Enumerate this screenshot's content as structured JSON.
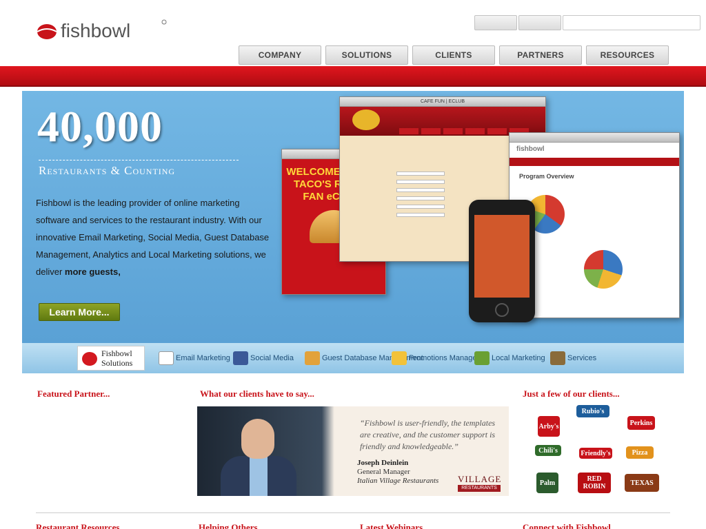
{
  "brand": {
    "logo_text": "fishbowl",
    "accent": "#c8131a"
  },
  "top_controls": {
    "button_1": "",
    "button_2": "",
    "search_placeholder": ""
  },
  "nav": {
    "items": [
      {
        "label": "COMPANY"
      },
      {
        "label": "SOLUTIONS"
      },
      {
        "label": "CLIENTS"
      },
      {
        "label": "PARTNERS"
      },
      {
        "label": "RESOURCES"
      }
    ]
  },
  "hero": {
    "heading": "40,000",
    "subheading": "Restaurants & Counting",
    "text_start": "Fishbowl is the leading provider of online marketing software and services to the restaurant industry. With our innovative Email Marketing, Social Media, Guest Database Management, Analytics and Local Marketing solutions, we deliver ",
    "text_bold": "more guests,",
    "learn_more": "Learn More...",
    "mock_deltaco_title": "WELCOME TO DEL TACO'S RAVING FAN eCLUB!",
    "mock_mimis_title": "CAFE FUN | ECLUB",
    "mock_fishbowl_title": "Program Overview"
  },
  "strip": {
    "partner_name": "Fishbowl Solutions",
    "items": [
      {
        "label": "Email Marketing",
        "icon": "envelope-icon"
      },
      {
        "label": "Social Media",
        "icon": "social-icon"
      },
      {
        "label": "Guest Database Management",
        "icon": "database-icon"
      },
      {
        "label": "Promotions Manager",
        "icon": "promotions-icon"
      },
      {
        "label": "Local Marketing",
        "icon": "store-icon"
      },
      {
        "label": "Services",
        "icon": "services-icon"
      }
    ]
  },
  "featured": {
    "heading": "Featured Partner..."
  },
  "testimonial": {
    "heading": "What our clients have to say...",
    "quote": "“Fishbowl is user-friendly, the templates are creative, and the customer support is friendly and knowledgeable.”",
    "name": "Joseph Deinlein",
    "title": "General Manager",
    "company": "Italian Village Restaurants",
    "logo_text": "VILLAGE",
    "logo_sub": "RESTAURANTS"
  },
  "clients": {
    "heading": "Just a few of our clients...",
    "logos": [
      {
        "name": "Arby's",
        "color": "#c8131a"
      },
      {
        "name": "Rubio's",
        "color": "#1d5d9b"
      },
      {
        "name": "Perkins",
        "color": "#c8131a"
      },
      {
        "name": "Chili's",
        "color": "#2f6b2a"
      },
      {
        "name": "Friendly's",
        "color": "#c8131a"
      },
      {
        "name": "Pizza",
        "color": "#e2921c"
      },
      {
        "name": "Palm",
        "color": "#2b5b2d"
      },
      {
        "name": "RED ROBIN",
        "color": "#b80e12"
      },
      {
        "name": "TEXAS",
        "color": "#8a3a16"
      }
    ]
  },
  "footer": {
    "headings": [
      "Restaurant Resources",
      "Helping Others",
      "Latest Webinars",
      "Connect with Fishbowl"
    ]
  }
}
